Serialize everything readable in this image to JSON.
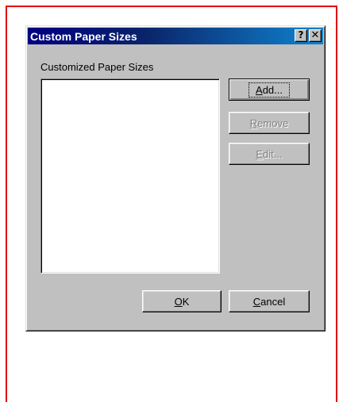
{
  "dialog": {
    "title": "Custom Paper Sizes",
    "help_button": "?",
    "close_button": "✕",
    "section_label": "Customized Paper Sizes",
    "paper_sizes": []
  },
  "buttons": {
    "add": {
      "mnemonic": "A",
      "rest": "dd..."
    },
    "remove": {
      "mnemonic": "R",
      "rest": "emove"
    },
    "edit": {
      "mnemonic": "E",
      "rest": "dit..."
    },
    "ok": {
      "mnemonic": "O",
      "rest": "K"
    },
    "cancel": {
      "mnemonic": "C",
      "rest": "ancel"
    }
  },
  "colors": {
    "title_bar": "#000080",
    "face": "#c0c0c0",
    "annotation_frame": "#e00000"
  }
}
